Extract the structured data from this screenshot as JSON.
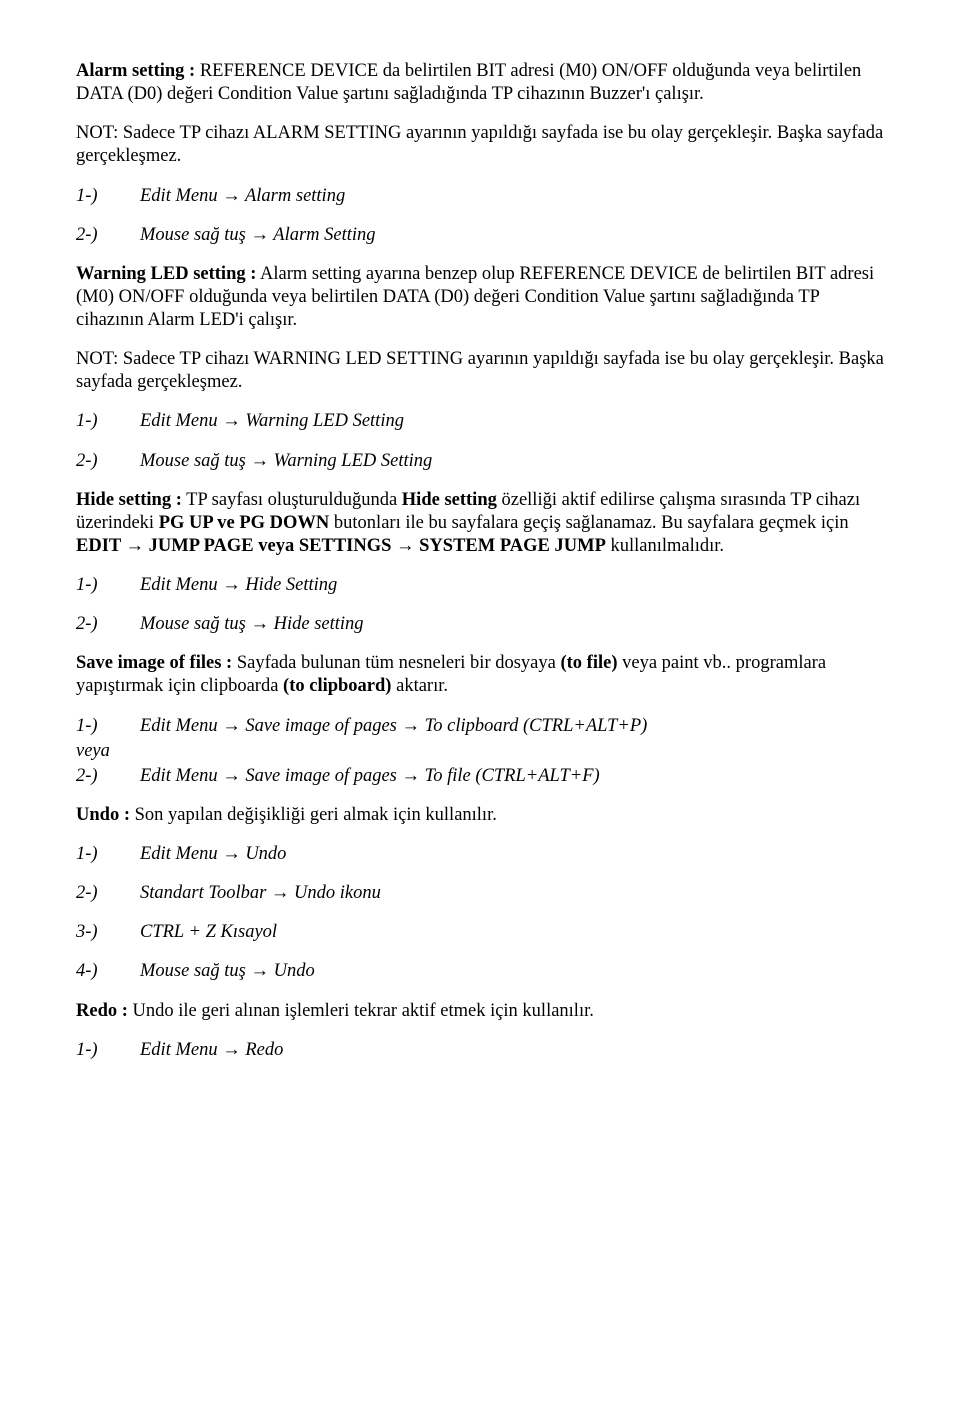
{
  "p1": {
    "b1": "Alarm setting :",
    "t1": " REFERENCE DEVICE da belirtilen BIT adresi (M0) ON/OFF olduğunda veya belirtilen DATA (D0) değeri Condition Value şartını sağladığında TP cihazının Buzzer'ı çalışır.",
    "t2": "NOT: Sadece TP cihazı ALARM SETTING ayarının yapıldığı sayfada ise bu olay gerçekleşir. Başka sayfada gerçekleşmez."
  },
  "r1": {
    "num": "1-)",
    "txt": "Edit Menu → Alarm setting"
  },
  "r2": {
    "num": "2-)",
    "txt": "Mouse sağ tuş → Alarm Setting"
  },
  "p2": {
    "b1": "Warning LED setting :",
    "t1": " Alarm setting ayarına benzep olup REFERENCE DEVICE de belirtilen BIT adresi (M0) ON/OFF olduğunda veya belirtilen DATA (D0) değeri Condition Value şartını sağladığında TP cihazının Alarm LED'i çalışır.",
    "t2": "NOT: Sadece TP cihazı WARNING LED SETTING ayarının yapıldığı sayfada ise bu olay gerçekleşir. Başka sayfada gerçekleşmez."
  },
  "r3": {
    "num": "1-)",
    "txt": "Edit Menu → Warning LED Setting"
  },
  "r4": {
    "num": "2-)",
    "txt": "Mouse sağ tuş → Warning LED Setting"
  },
  "p3": {
    "b1": "Hide setting :",
    "t1": " TP sayfası oluşturulduğunda ",
    "b2": "Hide setting",
    "t2": " özelliği aktif edilirse çalışma sırasında TP cihazı üzerindeki ",
    "b3": "PG UP ve PG DOWN",
    "t3": " butonları ile bu sayfalara geçiş sağlanamaz. Bu sayfalara geçmek için ",
    "b4": "EDIT → JUMP PAGE veya SETTINGS → SYSTEM PAGE JUMP",
    "t4": " kullanılmalıdır."
  },
  "r5": {
    "num": "1-)",
    "txt": "Edit Menu → Hide Setting"
  },
  "r6": {
    "num": "2-)",
    "txt": "Mouse sağ tuş → Hide setting"
  },
  "p4": {
    "b1": "Save image of files :",
    "t1": " Sayfada bulunan tüm nesneleri bir dosyaya ",
    "b2": "(to file)",
    "t2": " veya paint vb.. programlara yapıştırmak için clipboarda ",
    "b3": "(to clipboard)",
    "t3": " aktarır."
  },
  "r7": {
    "num": "1-)",
    "txt": "Edit Menu → Save image of pages → To clipboard (CTRL+ALT+P)"
  },
  "veya": "veya",
  "r8": {
    "num": "2-)",
    "txt": "Edit Menu → Save image of pages → To file (CTRL+ALT+F)"
  },
  "p5": {
    "b1": "Undo :",
    "t1": " Son yapılan değişikliği geri almak için kullanılır."
  },
  "r9": {
    "num": "1-)",
    "txt": "Edit Menu → Undo"
  },
  "r10": {
    "num": "2-)",
    "txt": "Standart Toolbar → Undo ikonu"
  },
  "r11": {
    "num": "3-)",
    "txt": "CTRL + Z Kısayol"
  },
  "r12": {
    "num": "4-)",
    "txt": "Mouse sağ tuş → Undo"
  },
  "p6": {
    "b1": "Redo :",
    "t1": " Undo ile geri alınan işlemleri tekrar aktif etmek için kullanılır."
  },
  "r13": {
    "num": "1-)",
    "txt": "Edit Menu → Redo"
  }
}
